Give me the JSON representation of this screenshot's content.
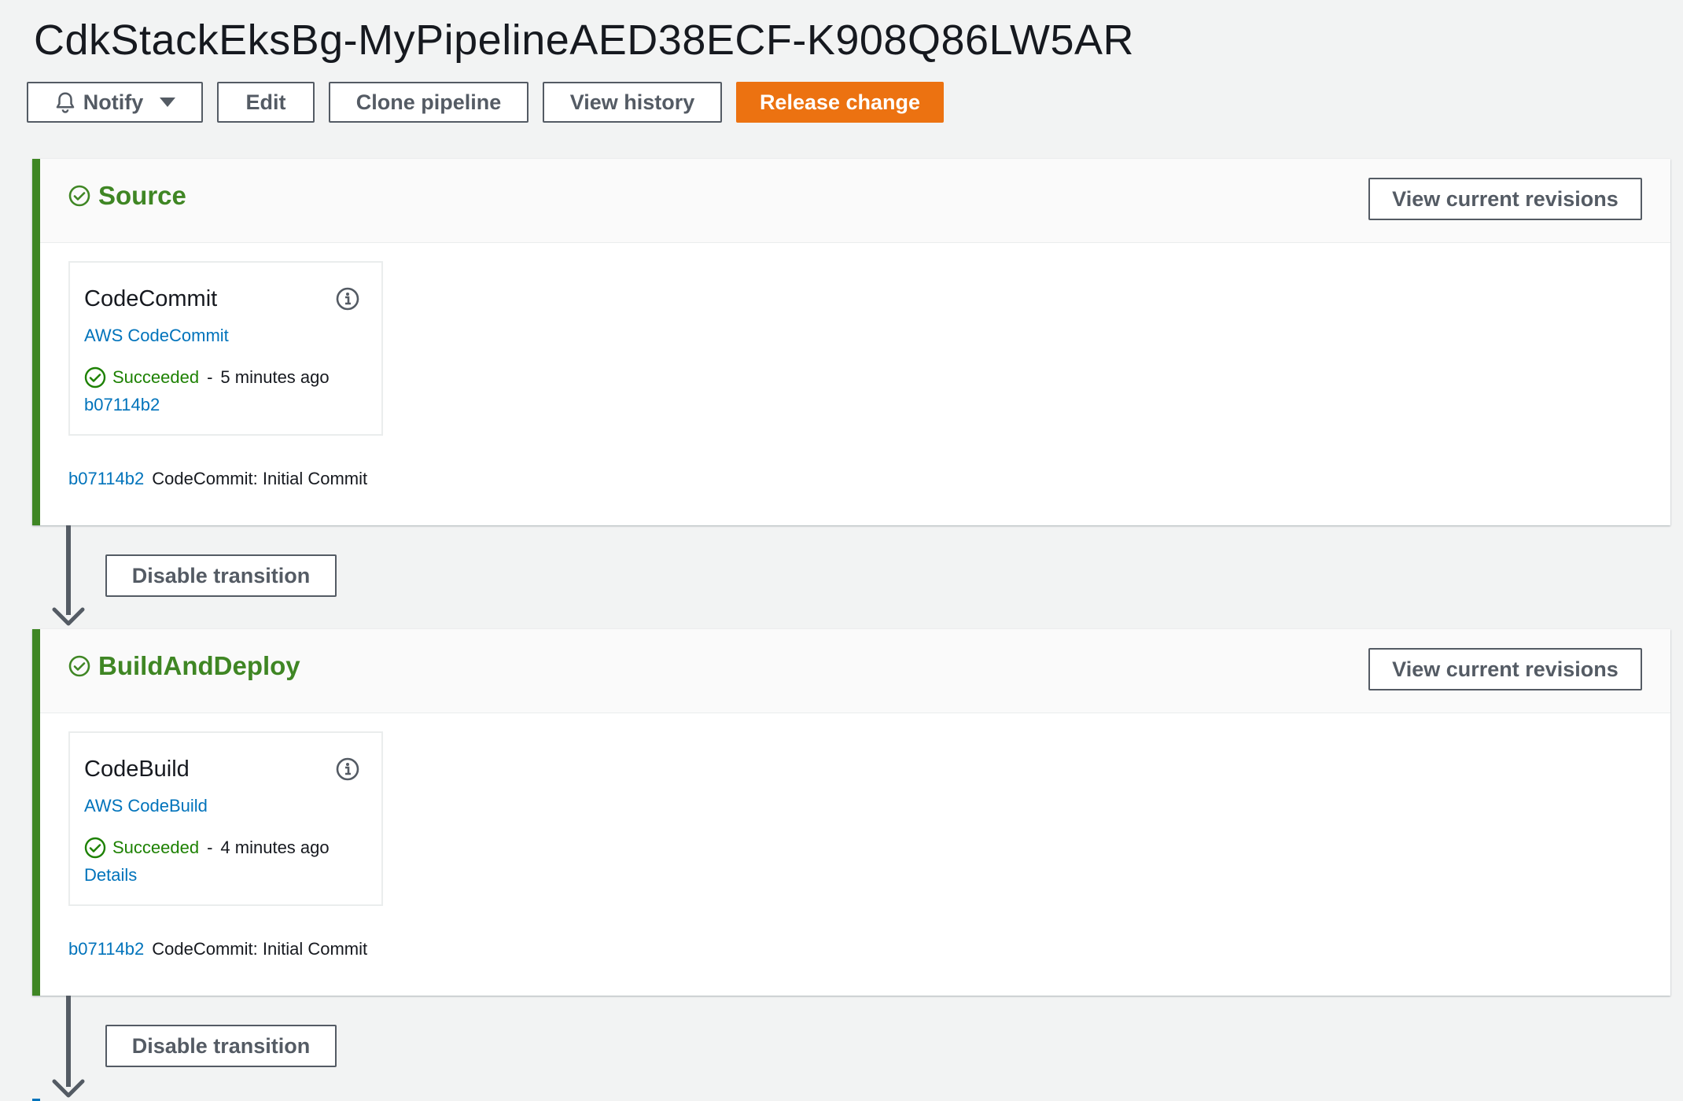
{
  "page": {
    "title": "CdkStackEksBg-MyPipelineAED38ECF-K908Q86LW5AR"
  },
  "toolbar": {
    "notify_label": "Notify",
    "edit_label": "Edit",
    "clone_label": "Clone pipeline",
    "history_label": "View history",
    "release_label": "Release change"
  },
  "colors": {
    "success": "#3f8624",
    "primary": "#ec7211",
    "link": "#0073bb",
    "background": "#f2f3f3"
  },
  "stages": [
    {
      "name": "Source",
      "revisions_button": "View current revisions",
      "action": {
        "name": "CodeCommit",
        "provider": "AWS CodeCommit",
        "status": "Succeeded",
        "separator": "-",
        "time": "5 minutes ago",
        "link": "b07114b2"
      },
      "commit": {
        "id": "b07114b2",
        "message": "CodeCommit: Initial Commit"
      },
      "transition_button": "Disable transition"
    },
    {
      "name": "BuildAndDeploy",
      "revisions_button": "View current revisions",
      "action": {
        "name": "CodeBuild",
        "provider": "AWS CodeBuild",
        "status": "Succeeded",
        "separator": "-",
        "time": "4 minutes ago",
        "link": "Details"
      },
      "commit": {
        "id": "b07114b2",
        "message": "CodeCommit: Initial Commit"
      },
      "transition_button": "Disable transition"
    }
  ],
  "icons": {
    "stage_status": "check-circle-icon",
    "action_info": "info-icon",
    "notify": "bell-icon",
    "dropdown": "caret-down-icon",
    "transition": "arrow-down-icon"
  }
}
